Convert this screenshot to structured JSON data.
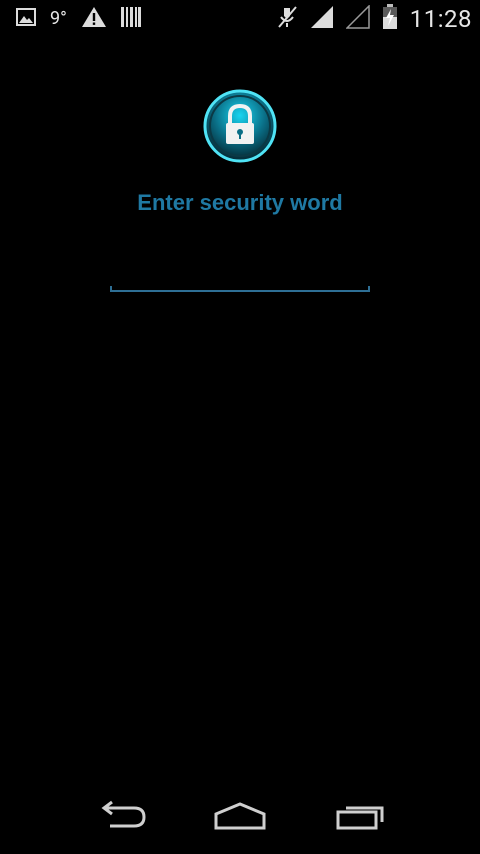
{
  "status_bar": {
    "temperature": "9°",
    "time": "11:28",
    "icons": [
      "gallery-icon",
      "warning-icon",
      "barcode-icon",
      "mute-icon",
      "signal-icon",
      "signal-empty-icon",
      "battery-icon"
    ]
  },
  "lock_screen": {
    "prompt": "Enter security word",
    "input_value": "",
    "input_placeholder": ""
  },
  "colors": {
    "accent": "#1f79a3",
    "underline": "#2e6f95",
    "ring": "#1ec8e6"
  },
  "navigation": {
    "buttons": [
      "back-icon",
      "home-icon",
      "recents-icon"
    ]
  }
}
